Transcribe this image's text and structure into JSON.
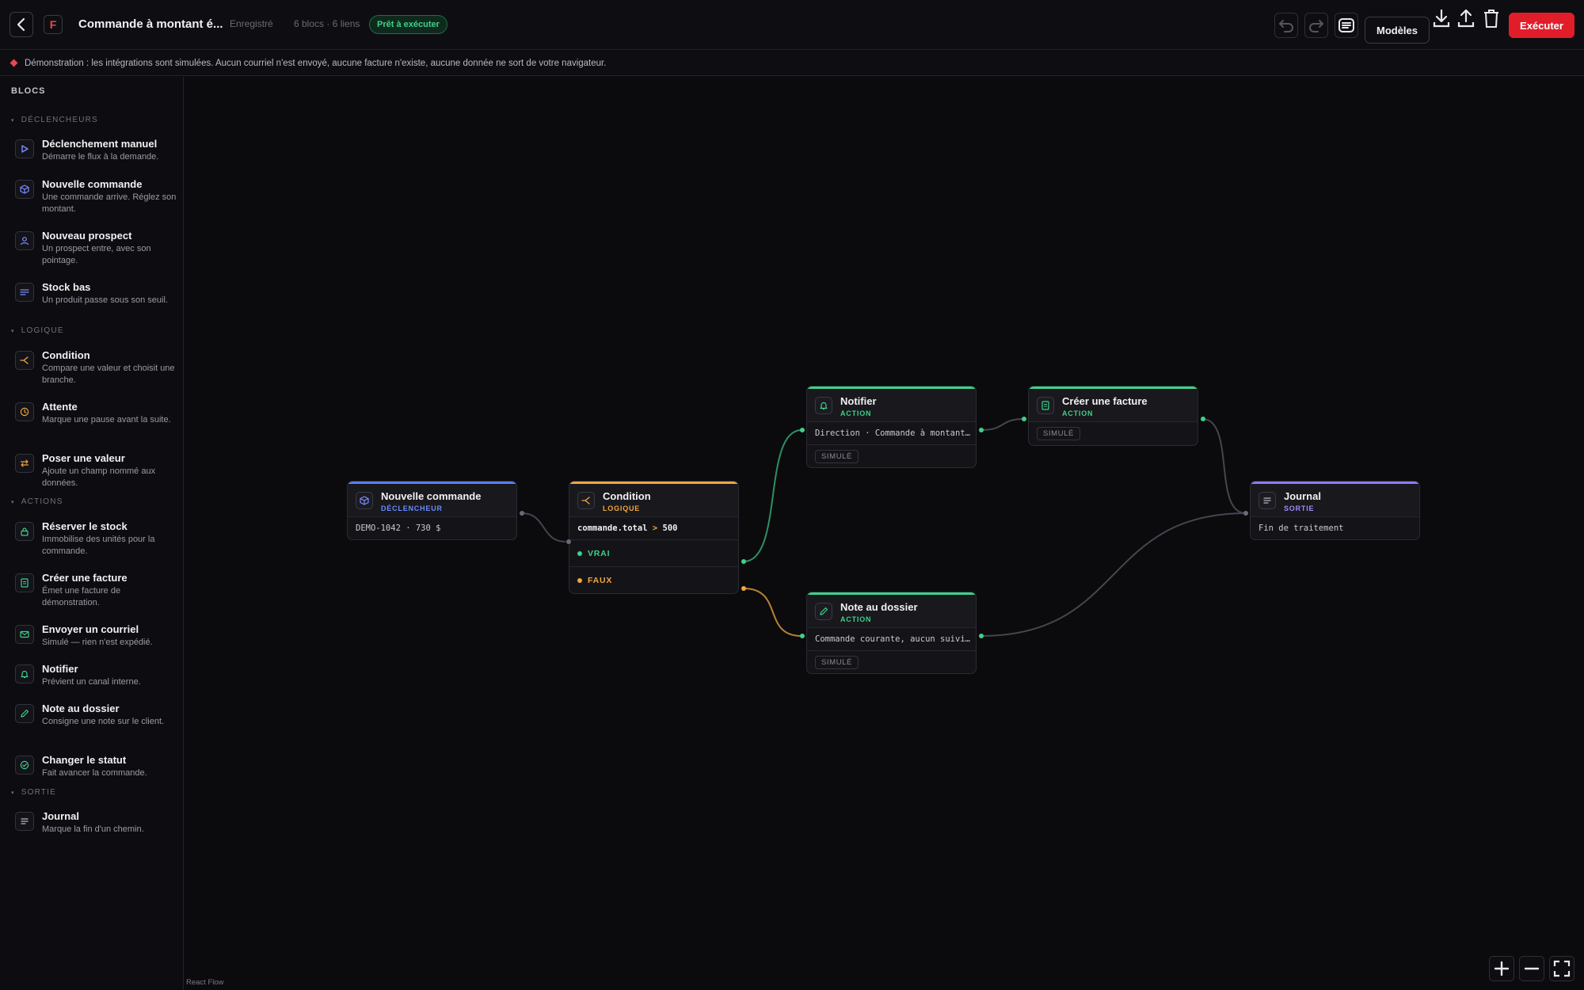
{
  "header": {
    "back_icon": "chevron-left-icon",
    "logo_letter": "F",
    "title": "Commande à montant é...",
    "save_status": "Enregistré",
    "counts": "6 blocs · 6 liens",
    "ready_badge": "Prêt à exécuter",
    "undo_icon": "undo-icon",
    "redo_icon": "redo-icon",
    "notes_icon": "notes-icon",
    "templates_label": "Modèles",
    "download_icon": "download-icon",
    "upload_icon": "upload-icon",
    "delete_icon": "trash-icon",
    "run_label": "Exécuter"
  },
  "banner": {
    "text": "Démonstration : les intégrations sont simulées. Aucun courriel n'est envoyé, aucune facture n'existe, aucune donnée ne sort de votre navigateur."
  },
  "sidebar": {
    "title": "BLOCS",
    "groups": [
      {
        "label": "DÉCLENCHEURS",
        "items": [
          {
            "name": "Déclenchement manuel",
            "desc": "Démarre le flux à la demande.",
            "icon": "play-icon",
            "color": "#7b8cff"
          },
          {
            "name": "Nouvelle commande",
            "desc": "Une commande arrive. Réglez son montant.",
            "icon": "box-icon",
            "color": "#7b8cff"
          },
          {
            "name": "Nouveau prospect",
            "desc": "Un prospect entre, avec son pointage.",
            "icon": "user-icon",
            "color": "#7b8cff"
          },
          {
            "name": "Stock bas",
            "desc": "Un produit passe sous son seuil.",
            "icon": "list-icon",
            "color": "#7b8cff"
          }
        ]
      },
      {
        "label": "LOGIQUE",
        "items": [
          {
            "name": "Condition",
            "desc": "Compare une valeur et choisit une branche.",
            "icon": "branch-icon",
            "color": "#f0a640"
          },
          {
            "name": "Attente",
            "desc": "Marque une pause avant la suite.",
            "icon": "clock-icon",
            "color": "#f0a640"
          },
          {
            "name": "Poser une valeur",
            "desc": "Ajoute un champ nommé aux données.",
            "icon": "swap-icon",
            "color": "#f0a640"
          }
        ]
      },
      {
        "label": "ACTIONS",
        "items": [
          {
            "name": "Réserver le stock",
            "desc": "Immobilise des unités pour la commande.",
            "icon": "lock-icon",
            "color": "#3fd08a"
          },
          {
            "name": "Créer une facture",
            "desc": "Émet une facture de démonstration.",
            "icon": "invoice-icon",
            "color": "#3fd08a"
          },
          {
            "name": "Envoyer un courriel",
            "desc": "Simulé — rien n'est expédié.",
            "icon": "mail-icon",
            "color": "#3fd08a"
          },
          {
            "name": "Notifier",
            "desc": "Prévient un canal interne.",
            "icon": "bell-icon",
            "color": "#3fd08a"
          },
          {
            "name": "Note au dossier",
            "desc": "Consigne une note sur le client.",
            "icon": "pencil-icon",
            "color": "#3fd08a"
          },
          {
            "name": "Changer le statut",
            "desc": "Fait avancer la commande.",
            "icon": "check-circle-icon",
            "color": "#3fd08a"
          }
        ]
      },
      {
        "label": "SORTIE",
        "items": [
          {
            "name": "Journal",
            "desc": "Marque la fin d'un chemin.",
            "icon": "journal-icon",
            "color": "#b8b8c2"
          }
        ]
      }
    ]
  },
  "nodes": {
    "order": {
      "title": "Nouvelle commande",
      "kind": "DÉCLENCHEUR",
      "body": "DEMO-1042 · 730 $",
      "icon": "box-icon",
      "color": "#6b8cff"
    },
    "condition": {
      "title": "Condition",
      "kind": "LOGIQUE",
      "expr_field": "commande.total",
      "expr_op": ">",
      "expr_value": "500",
      "true_label": "VRAI",
      "false_label": "FAUX",
      "icon": "branch-icon",
      "color": "#f0a640"
    },
    "notify": {
      "title": "Notifier",
      "kind": "ACTION",
      "body": "Direction · Commande à montant…",
      "pill": "SIMULÉ",
      "icon": "bell-icon",
      "color": "#3fd08a"
    },
    "invoice": {
      "title": "Créer une facture",
      "kind": "ACTION",
      "pill": "SIMULÉ",
      "icon": "invoice-icon",
      "color": "#3fd08a"
    },
    "note": {
      "title": "Note au dossier",
      "kind": "ACTION",
      "body": "Commande courante, aucun suivi…",
      "pill": "SIMULÉ",
      "icon": "pencil-icon",
      "color": "#3fd08a"
    },
    "journal": {
      "title": "Journal",
      "kind": "SORTIE",
      "body": "Fin de traitement",
      "icon": "journal-icon",
      "color": "#9d8cff"
    }
  },
  "canvas": {
    "attribution": "React Flow",
    "zoom_in_icon": "plus-icon",
    "zoom_out_icon": "minus-icon",
    "fit_view_icon": "fit-view-icon"
  }
}
